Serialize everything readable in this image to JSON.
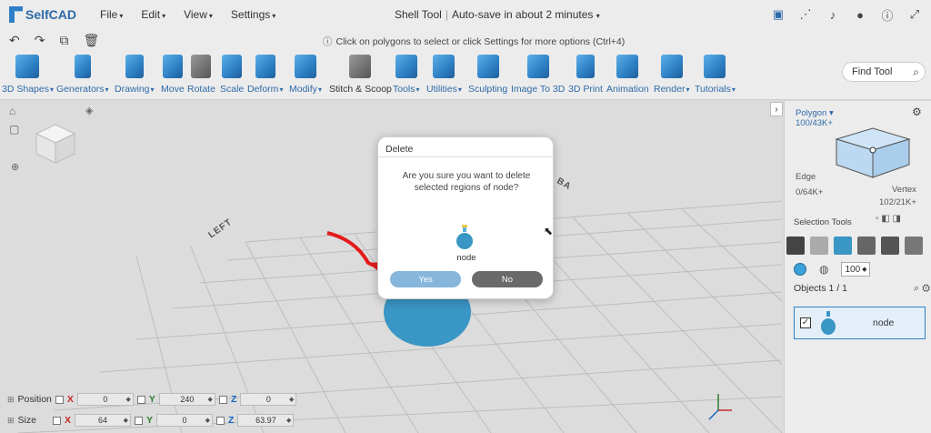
{
  "app": {
    "logo_text": "SelfCAD",
    "menu": [
      "File",
      "Edit",
      "View",
      "Settings"
    ],
    "title": "Shell Tool",
    "autosave": "Auto-save in about 2 minutes",
    "hint": "Click on polygons to select or click Settings for more options (Ctrl+4)"
  },
  "toolbar": {
    "items": [
      {
        "label": "3D Shapes",
        "icon": "cube-icon"
      },
      {
        "label": "Generators",
        "icon": "generator-icon"
      },
      {
        "label": "Drawing",
        "icon": "drawing-icon"
      },
      {
        "label": "Move",
        "icon": "move-icon"
      },
      {
        "label": "Rotate",
        "icon": "rotate-icon"
      },
      {
        "label": "Scale",
        "icon": "scale-icon"
      },
      {
        "label": "Deform",
        "icon": "deform-icon"
      },
      {
        "label": "Modify",
        "icon": "modify-icon"
      },
      {
        "label": "Stitch & Scoop",
        "icon": "stitch-icon"
      },
      {
        "label": "Tools",
        "icon": "tools-icon"
      },
      {
        "label": "Utilities",
        "icon": "utilities-icon"
      },
      {
        "label": "Sculpting",
        "icon": "sculpting-icon"
      },
      {
        "label": "Image To 3D",
        "icon": "image-to-3d-icon"
      },
      {
        "label": "3D Print",
        "icon": "3d-print-icon"
      },
      {
        "label": "Animation",
        "icon": "animation-icon"
      },
      {
        "label": "Render",
        "icon": "render-icon"
      },
      {
        "label": "Tutorials",
        "icon": "tutorials-icon"
      }
    ],
    "find_tool": "Find Tool"
  },
  "viewport": {
    "left_label": "LEFT",
    "back_label": "BA",
    "position": {
      "label": "Position",
      "x": "0",
      "y": "240",
      "z": "0"
    },
    "size": {
      "label": "Size",
      "x": "64",
      "y": "0",
      "z": "63.97"
    },
    "axis_x": "X",
    "axis_y": "Y",
    "axis_z": "Z"
  },
  "right_panel": {
    "polygon_label": "Polygon",
    "polygon_count": "100/43K+",
    "edge_label": "Edge",
    "edge_count": "0/64K+",
    "vertex_label": "Vertex",
    "vertex_count": "102/21K+",
    "selection_tools": "Selection Tools",
    "size_value": "100",
    "objects_label": "Objects 1 / 1",
    "object_name": "node",
    "accent": "#3aa0d8"
  },
  "dialog": {
    "title": "Delete",
    "message": "Are you sure you want to delete selected regions of node?",
    "node_label": "node",
    "yes": "Yes",
    "no": "No"
  }
}
